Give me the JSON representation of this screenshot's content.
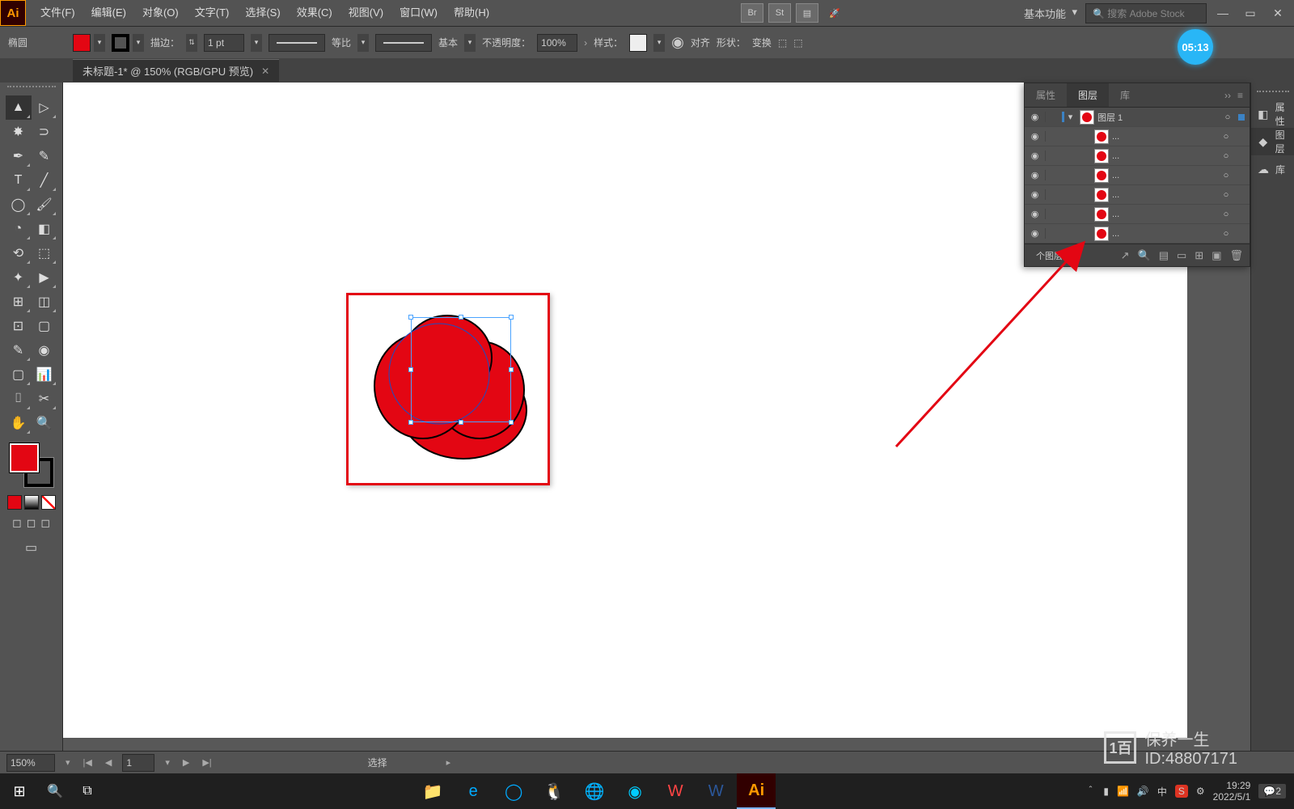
{
  "app_logo": "Ai",
  "menus": [
    "文件(F)",
    "编辑(E)",
    "对象(O)",
    "文字(T)",
    "选择(S)",
    "效果(C)",
    "视图(V)",
    "窗口(W)",
    "帮助(H)"
  ],
  "menubar_right_icons": [
    "Br",
    "St"
  ],
  "workspace": "基本功能",
  "search_placeholder": "搜索 Adobe Stock",
  "controlbar": {
    "tool_name": "椭圆",
    "fill": "#e30613",
    "stroke": "#000000",
    "stroke_label": "描边：",
    "stroke_weight": "1 pt",
    "profile": "等比",
    "brush": "基本",
    "opacity_label": "不透明度：",
    "opacity": "100%",
    "style_label": "样式：",
    "align_label": "对齐",
    "shape_label": "形状：",
    "transform_label": "变换"
  },
  "timer": "05:13",
  "doc_tab": "未标题-1* @ 150% (RGB/GPU 预览)",
  "tools_grid": [
    [
      "▶",
      "▷"
    ],
    [
      "✸",
      "✒"
    ],
    [
      "✎",
      "✒"
    ],
    [
      "T",
      "╱"
    ],
    [
      "◯",
      "🖌"
    ],
    [
      "◔",
      "◧"
    ],
    [
      "✂",
      "◫"
    ],
    [
      "⟲",
      "⬚"
    ],
    [
      "✦",
      "▶"
    ],
    [
      "⊞",
      "◫"
    ],
    [
      "⊡",
      "▢"
    ],
    [
      "✎",
      "📊"
    ],
    [
      "▢",
      "📊"
    ],
    [
      "⌷",
      "✒"
    ],
    [
      "✋",
      "🔍"
    ]
  ],
  "swatch_row": [
    "#e30613",
    "#888888"
  ],
  "layers_panel": {
    "tabs": [
      "属性",
      "图层",
      "库"
    ],
    "active_tab": 1,
    "parent_layer": "图层 1",
    "children": [
      "...",
      "...",
      "...",
      "...",
      "...",
      "..."
    ],
    "footer_label": "个图层"
  },
  "dock_items": [
    {
      "icon": "◧",
      "label": "属性"
    },
    {
      "icon": "◆",
      "label": "图层"
    },
    {
      "icon": "☁",
      "label": "库"
    }
  ],
  "status": {
    "zoom": "150%",
    "page": "1",
    "mode": "选择"
  },
  "taskbar": {
    "tray_icons": [
      "＾",
      "▮",
      "📶",
      "🔊",
      "中",
      "S",
      "⚙"
    ],
    "time": "19:29",
    "date": "2022/5/1",
    "notif": "2"
  },
  "watermark": {
    "line1": "保养一生",
    "line2": "ID:48807171"
  }
}
